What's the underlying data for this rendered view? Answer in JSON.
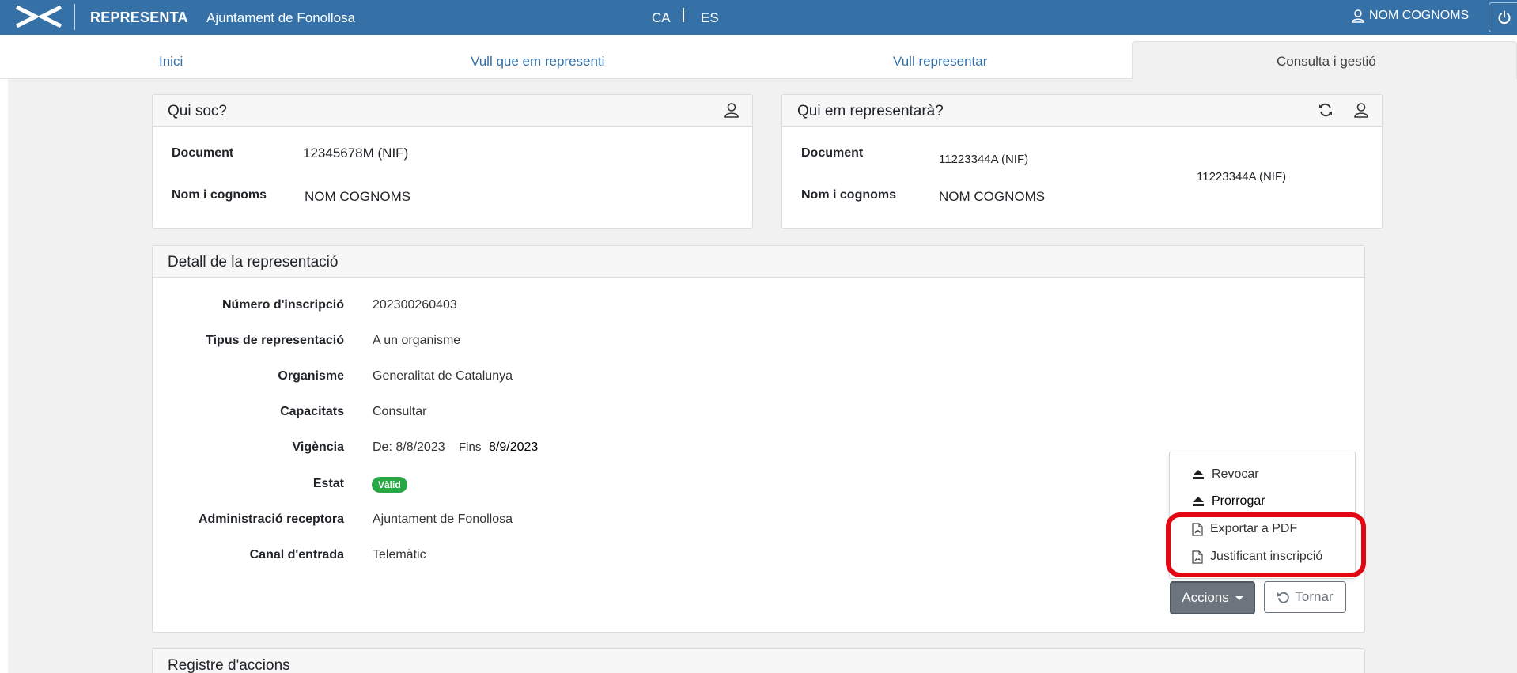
{
  "header": {
    "brand": "REPRESENTA",
    "organization": "Ajuntament de Fonollosa",
    "languages": [
      "CA",
      "ES"
    ],
    "user_name": "NOM COGNOMS"
  },
  "nav": {
    "tabs": [
      "Inici",
      "Vull que em representi",
      "Vull representar",
      "Consulta i gestió"
    ],
    "active_tab": "Consulta i gestió"
  },
  "who_am_i": {
    "title": "Qui soc?",
    "document_label": "Document",
    "document_value": "12345678M (NIF)",
    "name_label": "Nom i cognoms",
    "name_value": "NOM COGNOMS"
  },
  "representative": {
    "title": "Qui em representarà?",
    "document_label": "Document",
    "document_value": "11223344A (NIF)",
    "document_value_extra": "11223344A (NIF)",
    "name_label": "Nom i cognoms",
    "name_value": "NOM COGNOMS"
  },
  "detail": {
    "title": "Detall de la representació",
    "fields": [
      {
        "label": "Número d'inscripció",
        "value": "202300260403"
      },
      {
        "label": "Tipus de representació",
        "value": "A un organisme"
      },
      {
        "label": "Organisme",
        "value": "Generalitat de Catalunya"
      },
      {
        "label": "Capacitats",
        "value": "Consultar"
      },
      {
        "label": "Vigència",
        "value": "De: 8/8/2023"
      },
      {
        "label": "Estat",
        "value": ""
      },
      {
        "label": "Administració receptora",
        "value": "Ajuntament de Fonollosa"
      },
      {
        "label": "Canal d'entrada",
        "value": "Telemàtic"
      }
    ],
    "validity_end_label": "Fins",
    "validity_end_value": "8/9/2023",
    "status_badge": "Vàlid"
  },
  "actions": {
    "menu": [
      {
        "label": "Revocar",
        "icon": "eject-icon"
      },
      {
        "label": "Prorrogar",
        "icon": "eject-icon"
      },
      {
        "label": "Exportar a PDF",
        "icon": "pdf-file-icon"
      },
      {
        "label": "Justificant inscripció",
        "icon": "pdf-file-icon"
      }
    ],
    "accions_button": "Accions",
    "tornar_button": "Tornar"
  },
  "log": {
    "title": "Registre d'accions"
  },
  "colors": {
    "primary": "#3571a6",
    "success": "#28a745",
    "highlight": "#e30613",
    "secondary": "#6c757d"
  }
}
